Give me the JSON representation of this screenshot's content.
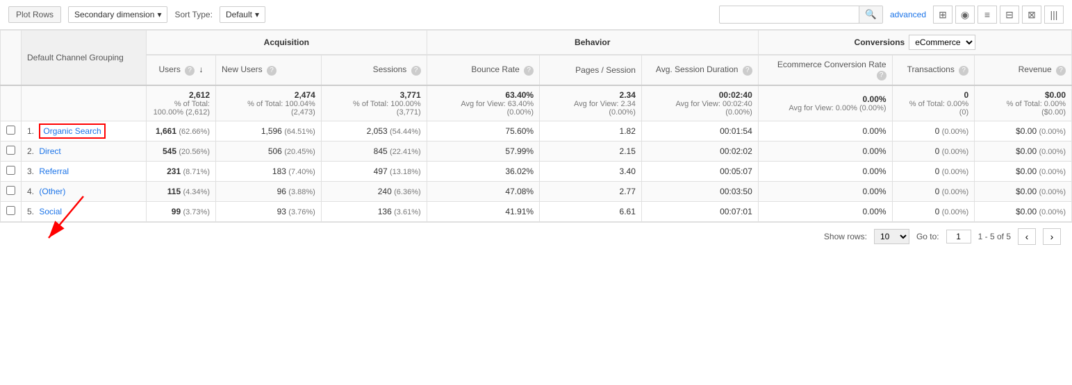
{
  "toolbar": {
    "plot_rows_label": "Plot Rows",
    "secondary_dimension_label": "Secondary dimension",
    "sort_type_label": "Sort Type:",
    "sort_default": "Default",
    "search_placeholder": "",
    "advanced_label": "advanced"
  },
  "view_icons": [
    "⊞",
    "◉",
    "≡",
    "⊟",
    "⊠",
    "|||"
  ],
  "table": {
    "group_col": "Default Channel Grouping",
    "acquisition_label": "Acquisition",
    "behavior_label": "Behavior",
    "conversions_label": "Conversions",
    "ecommerce_option": "eCommerce",
    "headers": {
      "users": "Users",
      "new_users": "New Users",
      "sessions": "Sessions",
      "bounce_rate": "Bounce Rate",
      "pages_session": "Pages / Session",
      "avg_session": "Avg. Session Duration",
      "ecommerce_rate": "Ecommerce Conversion Rate",
      "transactions": "Transactions",
      "revenue": "Revenue"
    },
    "totals": {
      "users": "2,612",
      "users_pct": "% of Total: 100.00% (2,612)",
      "new_users": "2,474",
      "new_users_pct": "% of Total: 100.04% (2,473)",
      "sessions": "3,771",
      "sessions_pct": "% of Total: 100.00% (3,771)",
      "bounce_rate": "63.40%",
      "bounce_rate_avg": "Avg for View: 63.40% (0.00%)",
      "pages_session": "2.34",
      "pages_session_avg": "Avg for View: 2.34 (0.00%)",
      "avg_session": "00:02:40",
      "avg_session_avg": "Avg for View: 00:02:40 (0.00%)",
      "ecommerce_rate": "0.00%",
      "ecommerce_rate_avg": "Avg for View: 0.00% (0.00%)",
      "transactions": "0",
      "transactions_pct": "% of Total: 0.00% (0)",
      "revenue": "$0.00",
      "revenue_pct": "% of Total: 0.00% ($0.00)"
    },
    "rows": [
      {
        "num": "1.",
        "channel": "Organic Search",
        "link": true,
        "highlight": true,
        "users": "1,661",
        "users_pct": "(62.66%)",
        "new_users": "1,596",
        "new_users_pct": "(64.51%)",
        "sessions": "2,053",
        "sessions_pct": "(54.44%)",
        "bounce_rate": "75.60%",
        "pages_session": "1.82",
        "avg_session": "00:01:54",
        "ecommerce_rate": "0.00%",
        "transactions": "0",
        "transactions_pct": "(0.00%)",
        "revenue": "$0.00",
        "revenue_pct": "(0.00%)"
      },
      {
        "num": "2.",
        "channel": "Direct",
        "link": true,
        "highlight": false,
        "users": "545",
        "users_pct": "(20.56%)",
        "new_users": "506",
        "new_users_pct": "(20.45%)",
        "sessions": "845",
        "sessions_pct": "(22.41%)",
        "bounce_rate": "57.99%",
        "pages_session": "2.15",
        "avg_session": "00:02:02",
        "ecommerce_rate": "0.00%",
        "transactions": "0",
        "transactions_pct": "(0.00%)",
        "revenue": "$0.00",
        "revenue_pct": "(0.00%)"
      },
      {
        "num": "3.",
        "channel": "Referral",
        "link": true,
        "highlight": false,
        "users": "231",
        "users_pct": "(8.71%)",
        "new_users": "183",
        "new_users_pct": "(7.40%)",
        "sessions": "497",
        "sessions_pct": "(13.18%)",
        "bounce_rate": "36.02%",
        "pages_session": "3.40",
        "avg_session": "00:05:07",
        "ecommerce_rate": "0.00%",
        "transactions": "0",
        "transactions_pct": "(0.00%)",
        "revenue": "$0.00",
        "revenue_pct": "(0.00%)"
      },
      {
        "num": "4.",
        "channel": "(Other)",
        "link": true,
        "highlight": false,
        "users": "115",
        "users_pct": "(4.34%)",
        "new_users": "96",
        "new_users_pct": "(3.88%)",
        "sessions": "240",
        "sessions_pct": "(6.36%)",
        "bounce_rate": "47.08%",
        "pages_session": "2.77",
        "avg_session": "00:03:50",
        "ecommerce_rate": "0.00%",
        "transactions": "0",
        "transactions_pct": "(0.00%)",
        "revenue": "$0.00",
        "revenue_pct": "(0.00%)"
      },
      {
        "num": "5.",
        "channel": "Social",
        "link": true,
        "highlight": false,
        "users": "99",
        "users_pct": "(3.73%)",
        "new_users": "93",
        "new_users_pct": "(3.76%)",
        "sessions": "136",
        "sessions_pct": "(3.61%)",
        "bounce_rate": "41.91%",
        "pages_session": "6.61",
        "avg_session": "00:07:01",
        "ecommerce_rate": "0.00%",
        "transactions": "0",
        "transactions_pct": "(0.00%)",
        "revenue": "$0.00",
        "revenue_pct": "(0.00%)"
      }
    ]
  },
  "footer": {
    "show_rows_label": "Show rows:",
    "show_rows_value": "10",
    "goto_label": "Go to:",
    "goto_value": "1",
    "pagination_text": "1 - 5 of 5"
  }
}
